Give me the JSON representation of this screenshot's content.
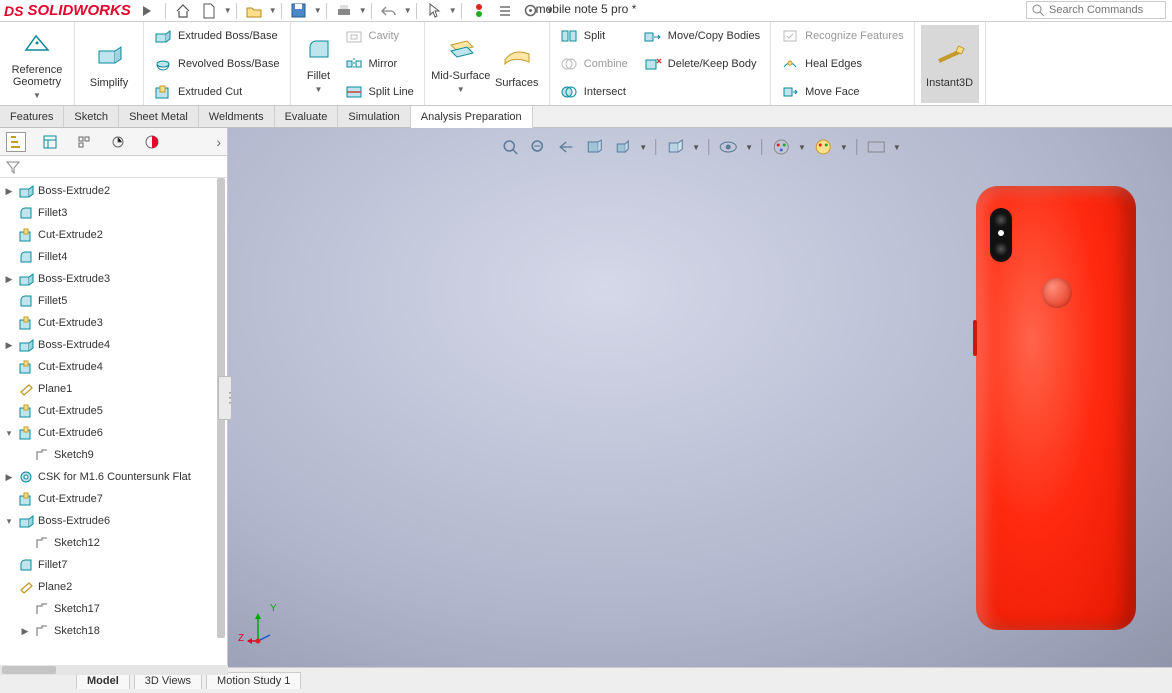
{
  "app": {
    "name": "SOLIDWORKS",
    "ds": "DS"
  },
  "title": "mobile note 5 pro *",
  "search": {
    "placeholder": "Search Commands"
  },
  "ribbon": {
    "refgeo": "Reference\nGeometry",
    "simplify": "Simplify",
    "extrudedBoss": "Extruded Boss/Base",
    "revolvedBoss": "Revolved Boss/Base",
    "extrudedCut": "Extruded Cut",
    "fillet": "Fillet",
    "cavity": "Cavity",
    "mirror": "Mirror",
    "splitline": "Split Line",
    "midsurface": "Mid-Surface",
    "surfaces": "Surfaces",
    "split": "Split",
    "combine": "Combine",
    "intersect": "Intersect",
    "movecopy": "Move/Copy Bodies",
    "deletekeep": "Delete/Keep Body",
    "recognize": "Recognize Features",
    "healedges": "Heal Edges",
    "moveface": "Move Face",
    "instant3d": "Instant3D"
  },
  "tabs": [
    "Features",
    "Sketch",
    "Sheet Metal",
    "Weldments",
    "Evaluate",
    "Simulation",
    "Analysis Preparation"
  ],
  "activeTab": 6,
  "tree": [
    {
      "tw": "▶",
      "ico": "extrude",
      "label": "Boss-Extrude2"
    },
    {
      "tw": "",
      "ico": "fillet",
      "label": "Fillet3"
    },
    {
      "tw": "",
      "ico": "cut",
      "label": "Cut-Extrude2"
    },
    {
      "tw": "",
      "ico": "fillet",
      "label": "Fillet4"
    },
    {
      "tw": "▶",
      "ico": "extrude",
      "label": "Boss-Extrude3"
    },
    {
      "tw": "",
      "ico": "fillet",
      "label": "Fillet5"
    },
    {
      "tw": "",
      "ico": "cut",
      "label": "Cut-Extrude3"
    },
    {
      "tw": "▶",
      "ico": "extrude",
      "label": "Boss-Extrude4"
    },
    {
      "tw": "",
      "ico": "cut",
      "label": "Cut-Extrude4"
    },
    {
      "tw": "",
      "ico": "plane",
      "label": "Plane1"
    },
    {
      "tw": "",
      "ico": "cut",
      "label": "Cut-Extrude5"
    },
    {
      "tw": "▾",
      "ico": "cut",
      "label": "Cut-Extrude6"
    },
    {
      "tw": "",
      "ico": "sketch",
      "label": "Sketch9",
      "child": true
    },
    {
      "tw": "▶",
      "ico": "hole",
      "label": "CSK for M1.6 Countersunk Flat"
    },
    {
      "tw": "",
      "ico": "cut",
      "label": "Cut-Extrude7"
    },
    {
      "tw": "▾",
      "ico": "extrude",
      "label": "Boss-Extrude6"
    },
    {
      "tw": "",
      "ico": "sketch",
      "label": "Sketch12",
      "child": true
    },
    {
      "tw": "",
      "ico": "fillet",
      "label": "Fillet7"
    },
    {
      "tw": "",
      "ico": "plane",
      "label": "Plane2"
    },
    {
      "tw": "",
      "ico": "sketch",
      "label": "Sketch17",
      "child": true
    },
    {
      "tw": "▶",
      "ico": "sketch",
      "label": "Sketch18",
      "child": true
    }
  ],
  "bottomTabs": [
    "Model",
    "3D Views",
    "Motion Study 1"
  ],
  "triad": {
    "y": "Y",
    "z": "Z"
  }
}
